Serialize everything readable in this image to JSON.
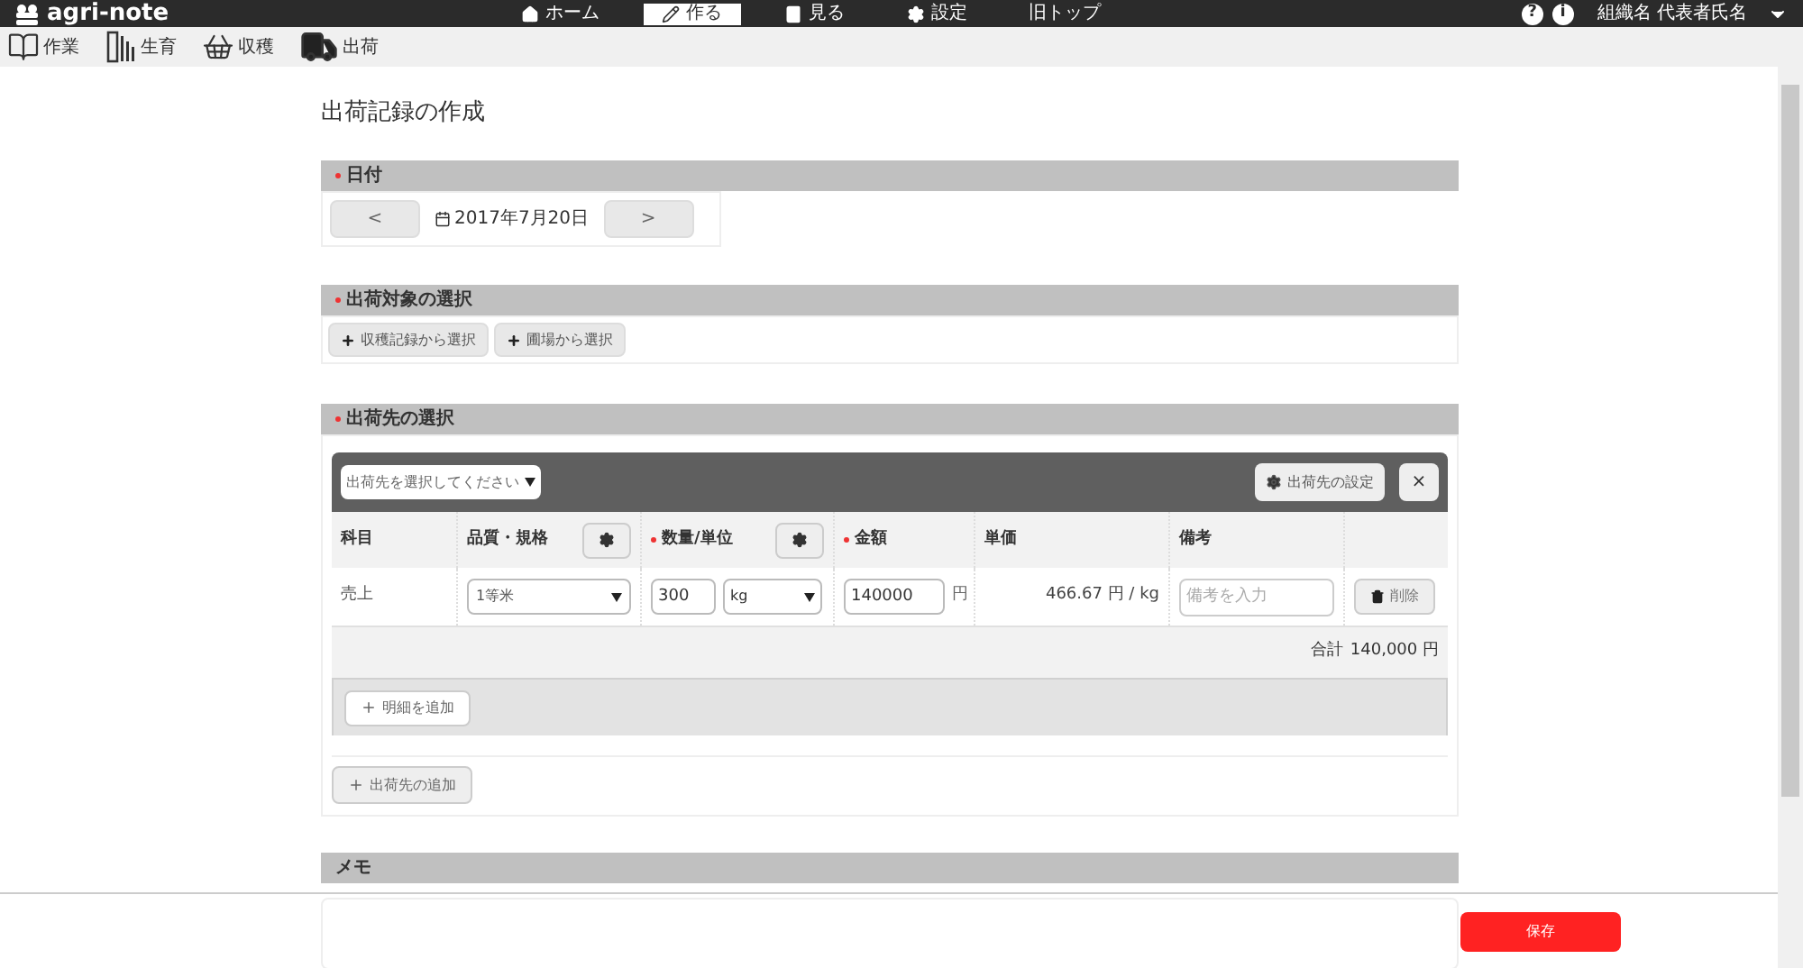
{
  "header": {
    "logo": "agri-note",
    "menu": [
      {
        "label": "ホーム",
        "selected": false
      },
      {
        "label": "作る",
        "selected": true
      },
      {
        "label": "見る",
        "selected": false
      },
      {
        "label": "設定",
        "selected": false
      },
      {
        "label": "旧トップ",
        "selected": false
      }
    ],
    "help": "?",
    "info": "i",
    "user": "組織名 代表者氏名"
  },
  "subnav": [
    {
      "label": "作業"
    },
    {
      "label": "生育"
    },
    {
      "label": "収穫"
    },
    {
      "label": "出荷"
    }
  ],
  "title": "出荷記録の作成",
  "date": {
    "label": "日付",
    "required": true,
    "prev": "<",
    "value": "2017年7月20日",
    "next": ">"
  },
  "target": {
    "label": "出荷対象の選択",
    "required": true,
    "buttons": [
      "収穫記録から選択",
      "圃場から選択"
    ]
  },
  "destination": {
    "label": "出荷先の選択",
    "required": true,
    "select": "出荷先を選択してください",
    "settings_button": "出荷先の設定",
    "close": "×",
    "columns": [
      {
        "label": "科目",
        "required": false,
        "settings": false
      },
      {
        "label": "品質・規格",
        "required": false,
        "settings": true
      },
      {
        "label": "数量/単位",
        "required": true,
        "settings": true
      },
      {
        "label": "金額",
        "required": true,
        "settings": false
      },
      {
        "label": "単価",
        "required": false,
        "settings": false
      },
      {
        "label": "備考",
        "required": false,
        "settings": false
      }
    ],
    "rows": [
      {
        "subject": "売上",
        "quality": "1等米",
        "quantity": "300",
        "unit": "kg",
        "amount": "140000",
        "currency": "円",
        "unit_price": "466.67 円 / kg",
        "note_placeholder": "備考を入力",
        "delete": "削除"
      }
    ],
    "total_label": "合計",
    "total": "140,000 円",
    "add_line": "明細を追加",
    "add_destination": "出荷先の追加"
  },
  "memo": {
    "label": "メモ",
    "required": false
  },
  "save": "保存"
}
